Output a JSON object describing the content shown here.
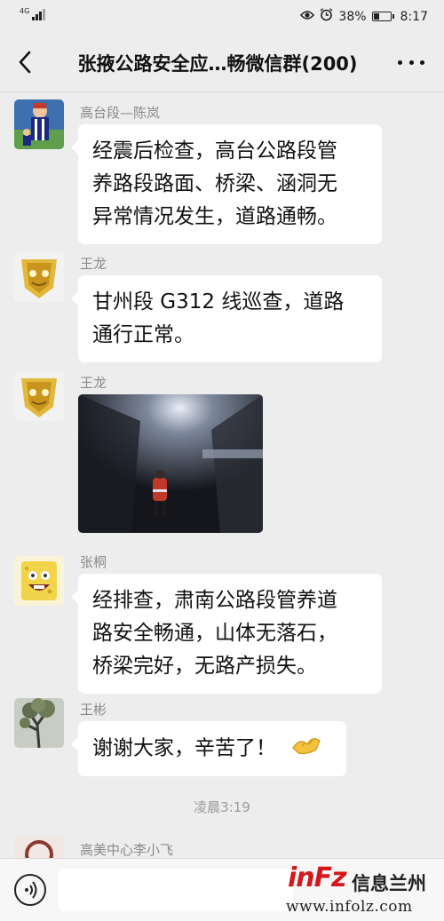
{
  "status_bar": {
    "network": "4G",
    "battery": "38%",
    "battery_level": 0.38,
    "time": "8:17"
  },
  "header": {
    "title": "张掖公路安全应…畅微信群(200)",
    "back_icon": "chevron-left-icon",
    "more_icon": "more-dots-icon"
  },
  "messages": [
    {
      "sender": "高台段—陈岚",
      "text_lines": [
        "经震后检查，高台公路段管",
        "养路段路面、桥梁、涵洞无",
        "异常情况发生，道路通畅。"
      ]
    },
    {
      "sender": "王龙",
      "text_lines": [
        "甘州段 G312 线巡查，道路",
        "通行正常。"
      ]
    },
    {
      "sender": "王龙",
      "image": "tunnel-inspection-photo"
    },
    {
      "sender": "张桐",
      "text_lines": [
        "经排查，肃南公路段管养道",
        "路安全畅通，山体无落石，",
        "桥梁完好，无路产损失。"
      ]
    },
    {
      "sender": "王彬",
      "text_lines": [
        "谢谢大家，辛苦了！"
      ],
      "emoji": "fist-bump-emoji"
    }
  ],
  "timestamp": "凌晨3:19",
  "partial_sender": "高美中心李小飞",
  "input_bar": {
    "voice_icon": "voice-icon"
  },
  "watermark": {
    "logo": "inFz",
    "name": "信息兰州",
    "url": "www.infolz.com"
  }
}
